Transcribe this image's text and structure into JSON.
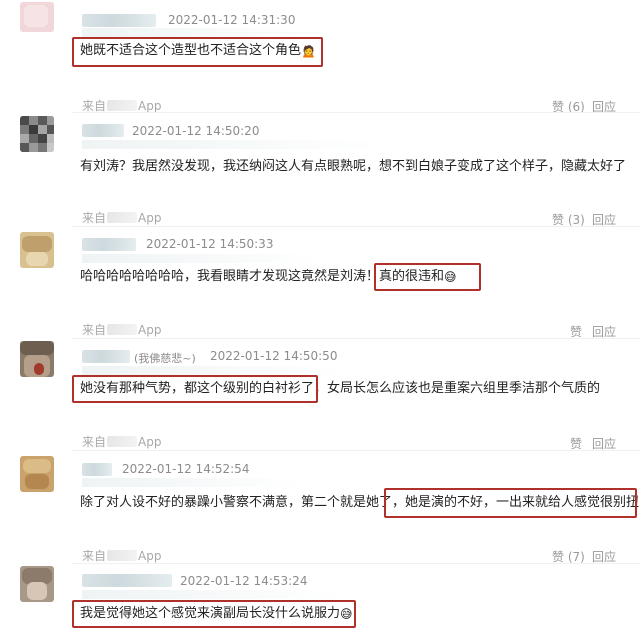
{
  "comments": [
    {
      "timestamp": "2022-01-12 14:31:30",
      "text_a": "她既不适合这个造型也不适合这个角色",
      "emoji": "🙍",
      "source_label": "来自",
      "source_app": "App",
      "like_label": "赞",
      "like_count": "(6)",
      "reply_label": "回应"
    },
    {
      "timestamp": "2022-01-12 14:50:20",
      "text_a": "有刘涛？我居然没发现，我还纳闷这人有点眼熟呢，想不到白娘子变成了这个样子，隐藏太好了",
      "source_label": "来自",
      "source_app": "App",
      "like_label": "赞",
      "like_count": "(3)",
      "reply_label": "回应"
    },
    {
      "timestamp": "2022-01-12 14:50:33",
      "text_a": "哈哈哈哈哈哈哈哈，我看眼睛才发现这竟然是刘涛！",
      "text_b": "真的很违和",
      "emoji": "😅",
      "source_label": "来自",
      "source_app": "App",
      "like_label": "赞",
      "reply_label": "回应"
    },
    {
      "timestamp": "2022-01-12 14:50:50",
      "name_note": "(我佛慈悲~)",
      "text_a": "她没有那种气势，都这个级别的白衬衫了，",
      "text_b": "女局长怎么应该也是重案六组里季洁那个气质的",
      "source_label": "来自",
      "source_app": "App",
      "like_label": "赞",
      "reply_label": "回应"
    },
    {
      "timestamp": "2022-01-12 14:52:54",
      "text_a": "除了对人设不好的暴躁小警察不满意，第二个就是她了，",
      "text_b": "她是演的不好，一出来就给人感觉很别扭",
      "source_label": "来自",
      "source_app": "App",
      "like_label": "赞",
      "like_count": "(7)",
      "reply_label": "回应"
    },
    {
      "timestamp": "2022-01-12 14:53:24",
      "text_a": "我是觉得她这个感觉来演副局长没什么说服力",
      "emoji": "😅"
    }
  ],
  "colors": {
    "highlight_border": "#b0302b",
    "timestamp": "#8c8c8c",
    "comment_text": "#222222",
    "meta_text": "#999999"
  }
}
